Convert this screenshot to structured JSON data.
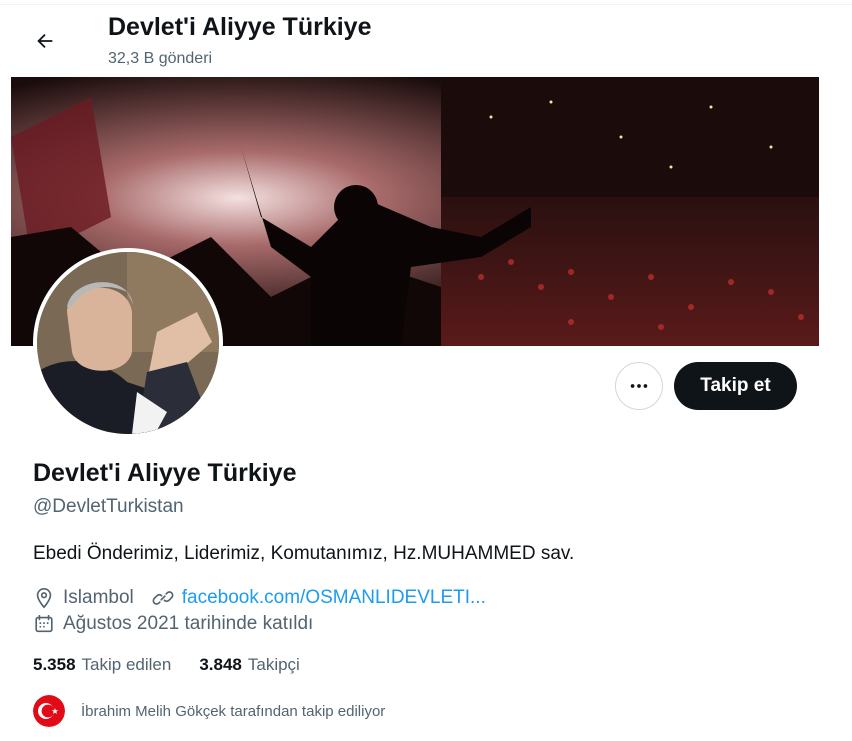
{
  "header": {
    "title": "Devlet'i Aliyye Türkiye",
    "post_count": "32,3 B gönderi"
  },
  "actions": {
    "follow_label": "Takip et"
  },
  "profile": {
    "name": "Devlet'i Aliyye Türkiye",
    "handle": "@DevletTurkistan",
    "bio": "Ebedi Önderimiz, Liderimiz, Komutanımız, Hz.MUHAMMED sav.",
    "location": "Islambol",
    "website": "facebook.com/OSMANLIDEVLETI...",
    "joined": "Ağustos 2021 tarihinde katıldı"
  },
  "stats": {
    "following_count": "5.358",
    "following_label": "Takip edilen",
    "followers_count": "3.848",
    "followers_label": "Takipçi"
  },
  "followed_by": {
    "text": "İbrahim Melih Gökçek tarafından takip ediliyor"
  },
  "colors": {
    "accent": "#1d9bf0",
    "text_primary": "#0f1419",
    "text_secondary": "#536471",
    "follow_button_bg": "#0f1419"
  },
  "icons": {
    "back": "arrow-left-icon",
    "more": "more-horizontal-icon",
    "location": "location-pin-icon",
    "website": "link-icon",
    "joined": "calendar-icon"
  }
}
